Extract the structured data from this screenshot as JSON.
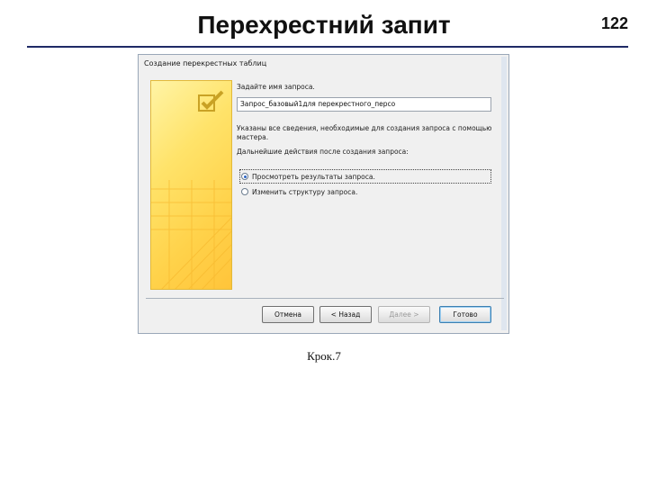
{
  "slide": {
    "title": "Перехрестний запит",
    "page_number": "122",
    "caption": "Крок.7"
  },
  "dialog": {
    "title": "Создание перекрестных таблиц",
    "prompt_name": "Задайте имя запроса.",
    "name_value": "Запрос_базовый1для перекрестного_персо",
    "info_line1": "Указаны все сведения, необходимые для создания запроса с помощью",
    "info_line2": "мастера.",
    "actions_prompt": "Дальнейшие действия после создания запроса:",
    "options": [
      {
        "label": "Просмотреть результаты запроса.",
        "selected": true
      },
      {
        "label": "Изменить структуру запроса.",
        "selected": false
      }
    ],
    "buttons": {
      "cancel": "Отмена",
      "back": "< Назад",
      "next": "Далее >",
      "finish": "Готово"
    }
  },
  "colors": {
    "title_rule": "#1f2a66",
    "wizard_panel": "#ffd24a"
  }
}
